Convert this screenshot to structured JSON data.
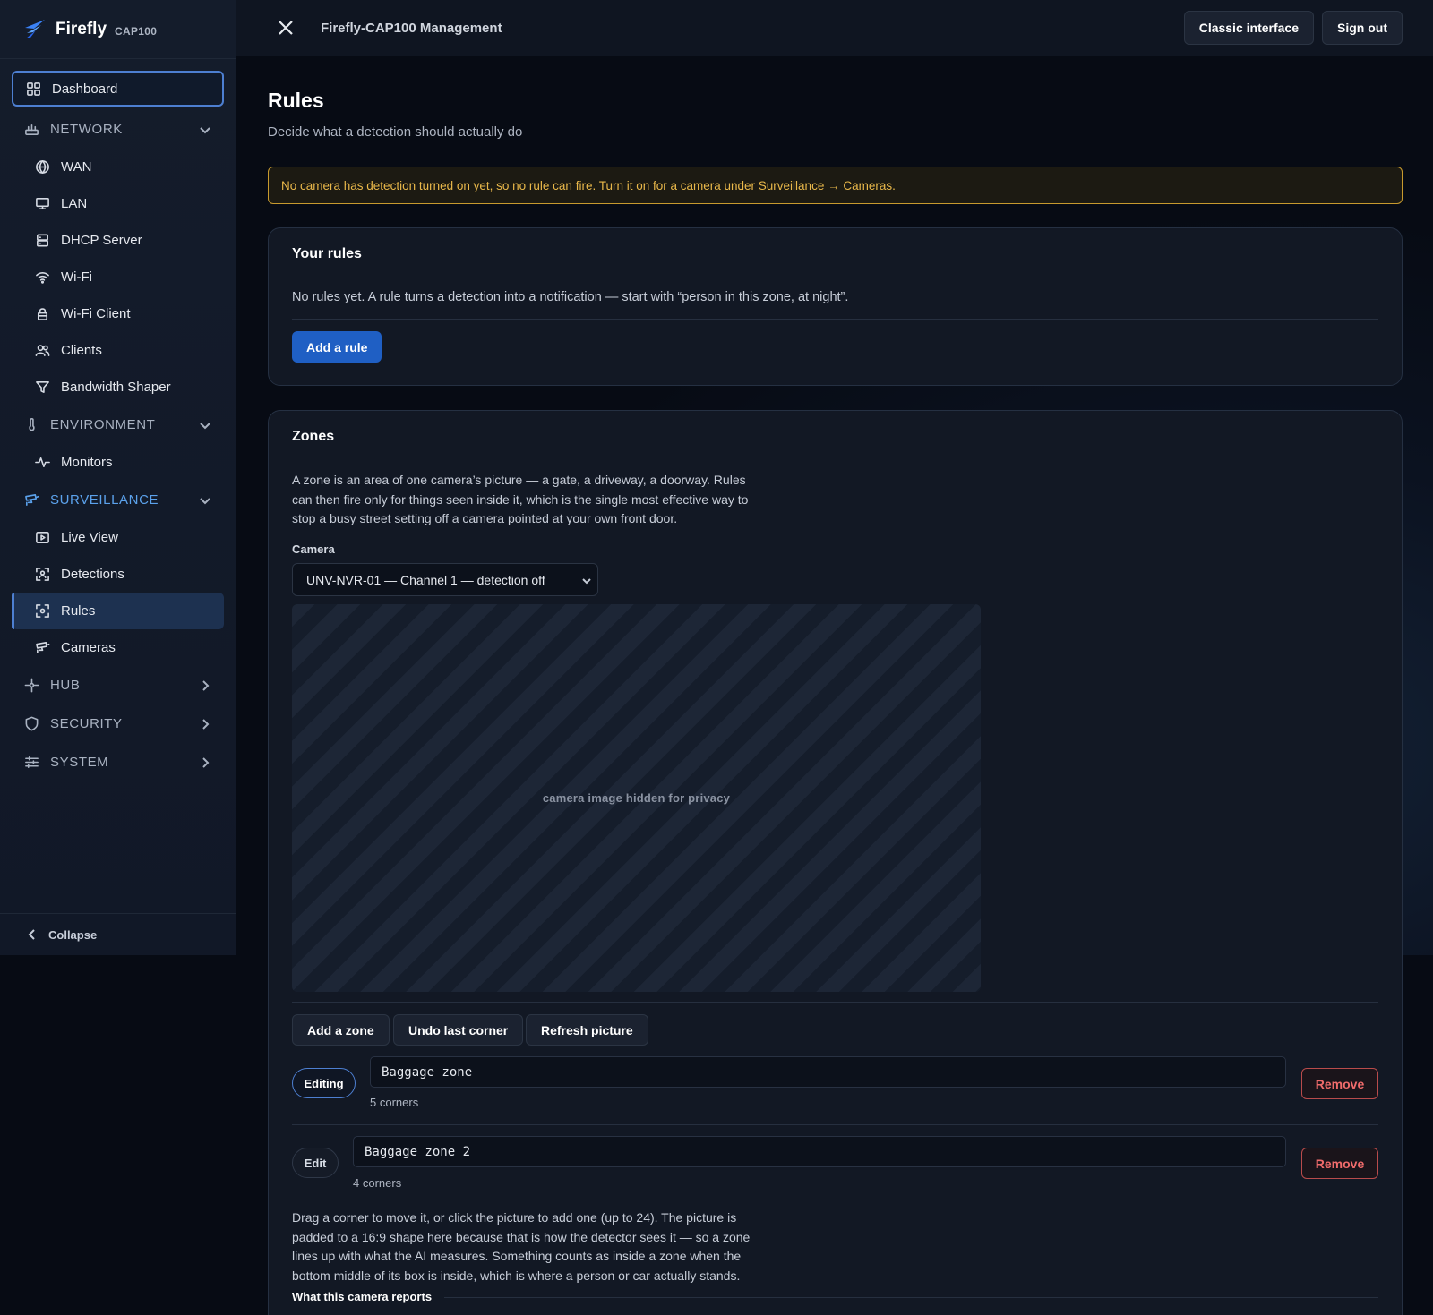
{
  "brand": {
    "name": "Firefly",
    "model": "CAP100"
  },
  "sidebar": {
    "dashboard": "Dashboard",
    "sections": {
      "network": {
        "label": "NETWORK",
        "items": [
          "WAN",
          "LAN",
          "DHCP Server",
          "Wi-Fi",
          "Wi-Fi Client",
          "Clients",
          "Bandwidth Shaper"
        ]
      },
      "environment": {
        "label": "ENVIRONMENT",
        "items": [
          "Monitors"
        ]
      },
      "surveillance": {
        "label": "SURVEILLANCE",
        "items": [
          "Live View",
          "Detections",
          "Rules",
          "Cameras"
        ]
      },
      "hub": {
        "label": "HUB"
      },
      "security": {
        "label": "SECURITY"
      },
      "system": {
        "label": "SYSTEM"
      }
    },
    "selected_item": "Rules",
    "collapse": "Collapse"
  },
  "topbar": {
    "title": "Firefly-CAP100 Management",
    "classic": "Classic interface",
    "sign_out": "Sign out"
  },
  "page": {
    "title": "Rules",
    "subtitle": "Decide what a detection should actually do",
    "warning": "No camera has detection turned on yet, so no rule can fire. Turn it on for a camera under Surveillance → Cameras."
  },
  "rules_card": {
    "title": "Your rules",
    "empty": "No rules yet. A rule turns a detection into a notification — start with “person in this zone, at night”.",
    "add": "Add a rule"
  },
  "zones_card": {
    "title": "Zones",
    "description": "A zone is an area of one camera’s picture — a gate, a driveway, a doorway. Rules can then fire only for things seen inside it, which is the single most effective way to stop a busy street setting off a camera pointed at your own front door.",
    "camera_label": "Camera",
    "camera_value": "UNV-NVR-01 — Channel 1 — detection off",
    "image_placeholder": "camera image hidden for privacy",
    "buttons": {
      "add_zone": "Add a zone",
      "undo": "Undo last corner",
      "refresh": "Refresh picture"
    },
    "zones": [
      {
        "state": "Editing",
        "name": "Baggage zone",
        "corners": "5 corners",
        "remove": "Remove"
      },
      {
        "state": "Edit",
        "name": "Baggage zone 2",
        "corners": "4 corners",
        "remove": "Remove"
      }
    ],
    "help": "Drag a corner to move it, or click the picture to add one (up to 24). The picture is padded to a 16:9 shape here because that is how the detector sees it — so a zone lines up with what the AI measures. Something counts as inside a zone when the bottom middle of its box is inside, which is where a person or car actually stands.",
    "reports_heading": "What this camera reports"
  },
  "colors": {
    "accent": "#4d7fd1",
    "surveillance": "#5ba2ec",
    "warning": "#e9b84a",
    "danger": "#ef6b6b",
    "primary_button": "#1f5fc4"
  }
}
